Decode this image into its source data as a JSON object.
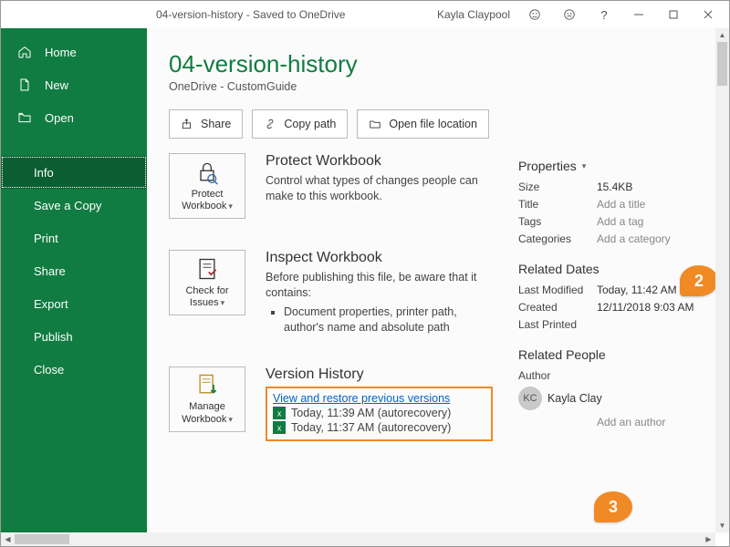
{
  "titlebar": {
    "title": "04-version-history - Saved to OneDrive",
    "user": "Kayla Claypool"
  },
  "sidebar": {
    "top": [
      {
        "id": "home",
        "label": "Home"
      },
      {
        "id": "new",
        "label": "New"
      },
      {
        "id": "open",
        "label": "Open"
      }
    ],
    "info": [
      {
        "id": "info",
        "label": "Info",
        "active": true
      },
      {
        "id": "save-a-copy",
        "label": "Save a Copy"
      },
      {
        "id": "print",
        "label": "Print"
      },
      {
        "id": "share",
        "label": "Share"
      },
      {
        "id": "export",
        "label": "Export"
      },
      {
        "id": "publish",
        "label": "Publish"
      },
      {
        "id": "close",
        "label": "Close"
      }
    ]
  },
  "page": {
    "title": "04-version-history",
    "subtitle": "OneDrive - CustomGuide"
  },
  "actions": {
    "share": "Share",
    "copy_path": "Copy path",
    "open_location": "Open file location"
  },
  "protect": {
    "button": "Protect Workbook",
    "heading": "Protect Workbook",
    "body": "Control what types of changes people can make to this workbook."
  },
  "inspect": {
    "button": "Check for Issues",
    "heading": "Inspect Workbook",
    "body": "Before publishing this file, be aware that it contains:",
    "bullet1": "Document properties, printer path, author's name and absolute path"
  },
  "version": {
    "button": "Manage Workbook",
    "heading": "Version History",
    "link": "View and restore previous versions",
    "v1": "Today, 11:39 AM (autorecovery)",
    "v2": "Today, 11:37 AM (autorecovery)"
  },
  "properties": {
    "heading": "Properties",
    "size_label": "Size",
    "size": "15.4KB",
    "title_label": "Title",
    "title_placeholder": "Add a title",
    "tags_label": "Tags",
    "tags_placeholder": "Add a tag",
    "categories_label": "Categories",
    "categories_placeholder": "Add a category",
    "dates_heading": "Related Dates",
    "last_modified_label": "Last Modified",
    "last_modified": "Today, 11:42 AM",
    "created_label": "Created",
    "created": "12/11/2018 9:03 AM",
    "last_printed_label": "Last Printed",
    "people_heading": "Related People",
    "author_label": "Author",
    "author_initials": "KC",
    "author_name": "Kayla Clay",
    "add_author": "Add an author"
  },
  "callouts": {
    "c2": "2",
    "c3": "3"
  }
}
